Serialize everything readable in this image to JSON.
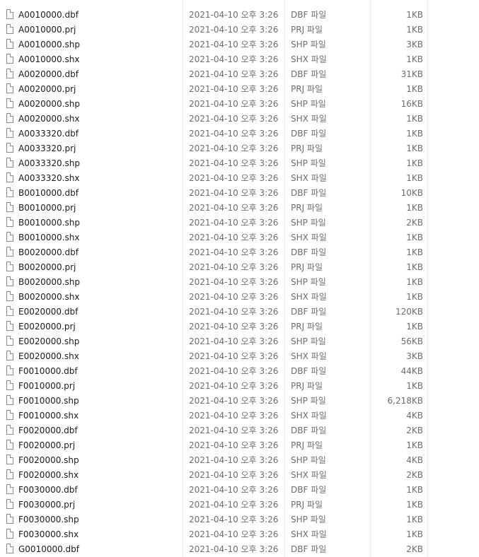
{
  "file_list": {
    "files": [
      {
        "name": "A0010000.dbf",
        "modified": "2021-04-10 오후 3:26",
        "type": "DBF 파일",
        "size": "1KB",
        "icon": "file-icon"
      },
      {
        "name": "A0010000.prj",
        "modified": "2021-04-10 오후 3:26",
        "type": "PRJ 파일",
        "size": "1KB",
        "icon": "file-icon"
      },
      {
        "name": "A0010000.shp",
        "modified": "2021-04-10 오후 3:26",
        "type": "SHP 파일",
        "size": "3KB",
        "icon": "file-icon"
      },
      {
        "name": "A0010000.shx",
        "modified": "2021-04-10 오후 3:26",
        "type": "SHX 파일",
        "size": "1KB",
        "icon": "file-icon"
      },
      {
        "name": "A0020000.dbf",
        "modified": "2021-04-10 오후 3:26",
        "type": "DBF 파일",
        "size": "31KB",
        "icon": "file-icon"
      },
      {
        "name": "A0020000.prj",
        "modified": "2021-04-10 오후 3:26",
        "type": "PRJ 파일",
        "size": "1KB",
        "icon": "file-icon"
      },
      {
        "name": "A0020000.shp",
        "modified": "2021-04-10 오후 3:26",
        "type": "SHP 파일",
        "size": "16KB",
        "icon": "file-icon"
      },
      {
        "name": "A0020000.shx",
        "modified": "2021-04-10 오후 3:26",
        "type": "SHX 파일",
        "size": "1KB",
        "icon": "file-icon"
      },
      {
        "name": "A0033320.dbf",
        "modified": "2021-04-10 오후 3:26",
        "type": "DBF 파일",
        "size": "1KB",
        "icon": "file-icon"
      },
      {
        "name": "A0033320.prj",
        "modified": "2021-04-10 오후 3:26",
        "type": "PRJ 파일",
        "size": "1KB",
        "icon": "file-icon"
      },
      {
        "name": "A0033320.shp",
        "modified": "2021-04-10 오후 3:26",
        "type": "SHP 파일",
        "size": "1KB",
        "icon": "file-icon"
      },
      {
        "name": "A0033320.shx",
        "modified": "2021-04-10 오후 3:26",
        "type": "SHX 파일",
        "size": "1KB",
        "icon": "file-icon"
      },
      {
        "name": "B0010000.dbf",
        "modified": "2021-04-10 오후 3:26",
        "type": "DBF 파일",
        "size": "10KB",
        "icon": "file-icon"
      },
      {
        "name": "B0010000.prj",
        "modified": "2021-04-10 오후 3:26",
        "type": "PRJ 파일",
        "size": "1KB",
        "icon": "file-icon"
      },
      {
        "name": "B0010000.shp",
        "modified": "2021-04-10 오후 3:26",
        "type": "SHP 파일",
        "size": "2KB",
        "icon": "file-icon"
      },
      {
        "name": "B0010000.shx",
        "modified": "2021-04-10 오후 3:26",
        "type": "SHX 파일",
        "size": "1KB",
        "icon": "file-icon"
      },
      {
        "name": "B0020000.dbf",
        "modified": "2021-04-10 오후 3:26",
        "type": "DBF 파일",
        "size": "1KB",
        "icon": "file-icon"
      },
      {
        "name": "B0020000.prj",
        "modified": "2021-04-10 오후 3:26",
        "type": "PRJ 파일",
        "size": "1KB",
        "icon": "file-icon"
      },
      {
        "name": "B0020000.shp",
        "modified": "2021-04-10 오후 3:26",
        "type": "SHP 파일",
        "size": "1KB",
        "icon": "file-icon"
      },
      {
        "name": "B0020000.shx",
        "modified": "2021-04-10 오후 3:26",
        "type": "SHX 파일",
        "size": "1KB",
        "icon": "file-icon"
      },
      {
        "name": "E0020000.dbf",
        "modified": "2021-04-10 오후 3:26",
        "type": "DBF 파일",
        "size": "120KB",
        "icon": "file-icon"
      },
      {
        "name": "E0020000.prj",
        "modified": "2021-04-10 오후 3:26",
        "type": "PRJ 파일",
        "size": "1KB",
        "icon": "file-icon"
      },
      {
        "name": "E0020000.shp",
        "modified": "2021-04-10 오후 3:26",
        "type": "SHP 파일",
        "size": "56KB",
        "icon": "file-icon"
      },
      {
        "name": "E0020000.shx",
        "modified": "2021-04-10 오후 3:26",
        "type": "SHX 파일",
        "size": "3KB",
        "icon": "file-icon"
      },
      {
        "name": "F0010000.dbf",
        "modified": "2021-04-10 오후 3:26",
        "type": "DBF 파일",
        "size": "44KB",
        "icon": "file-icon"
      },
      {
        "name": "F0010000.prj",
        "modified": "2021-04-10 오후 3:26",
        "type": "PRJ 파일",
        "size": "1KB",
        "icon": "file-icon"
      },
      {
        "name": "F0010000.shp",
        "modified": "2021-04-10 오후 3:26",
        "type": "SHP 파일",
        "size": "6,218KB",
        "icon": "file-icon"
      },
      {
        "name": "F0010000.shx",
        "modified": "2021-04-10 오후 3:26",
        "type": "SHX 파일",
        "size": "4KB",
        "icon": "file-icon"
      },
      {
        "name": "F0020000.dbf",
        "modified": "2021-04-10 오후 3:26",
        "type": "DBF 파일",
        "size": "2KB",
        "icon": "file-icon"
      },
      {
        "name": "F0020000.prj",
        "modified": "2021-04-10 오후 3:26",
        "type": "PRJ 파일",
        "size": "1KB",
        "icon": "file-icon"
      },
      {
        "name": "F0020000.shp",
        "modified": "2021-04-10 오후 3:26",
        "type": "SHP 파일",
        "size": "4KB",
        "icon": "file-icon"
      },
      {
        "name": "F0020000.shx",
        "modified": "2021-04-10 오후 3:26",
        "type": "SHX 파일",
        "size": "2KB",
        "icon": "file-icon"
      },
      {
        "name": "F0030000.dbf",
        "modified": "2021-04-10 오후 3:26",
        "type": "DBF 파일",
        "size": "1KB",
        "icon": "file-icon"
      },
      {
        "name": "F0030000.prj",
        "modified": "2021-04-10 오후 3:26",
        "type": "PRJ 파일",
        "size": "1KB",
        "icon": "file-icon"
      },
      {
        "name": "F0030000.shp",
        "modified": "2021-04-10 오후 3:26",
        "type": "SHP 파일",
        "size": "1KB",
        "icon": "file-icon"
      },
      {
        "name": "F0030000.shx",
        "modified": "2021-04-10 오후 3:26",
        "type": "SHX 파일",
        "size": "1KB",
        "icon": "file-icon"
      },
      {
        "name": "G0010000.dbf",
        "modified": "2021-04-10 오후 3:26",
        "type": "DBF 파일",
        "size": "2KB",
        "icon": "file-icon"
      }
    ]
  }
}
